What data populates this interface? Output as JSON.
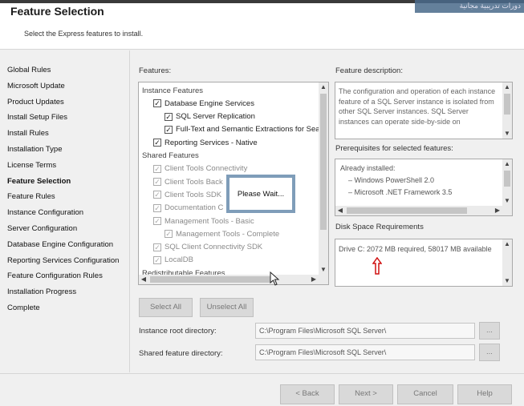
{
  "header": {
    "title": "Feature Selection",
    "subtitle": "Select the Express features to install.",
    "watermark": "دورات تدريبية مجانية"
  },
  "nav": {
    "items": [
      {
        "label": "Global Rules",
        "active": false
      },
      {
        "label": "Microsoft Update",
        "active": false
      },
      {
        "label": "Product Updates",
        "active": false
      },
      {
        "label": "Install Setup Files",
        "active": false
      },
      {
        "label": "Install Rules",
        "active": false
      },
      {
        "label": "Installation Type",
        "active": false
      },
      {
        "label": "License Terms",
        "active": false
      },
      {
        "label": "Feature Selection",
        "active": true
      },
      {
        "label": "Feature Rules",
        "active": false
      },
      {
        "label": "Instance Configuration",
        "active": false
      },
      {
        "label": "Server Configuration",
        "active": false
      },
      {
        "label": "Database Engine Configuration",
        "active": false
      },
      {
        "label": "Reporting Services Configuration",
        "active": false
      },
      {
        "label": "Feature Configuration Rules",
        "active": false
      },
      {
        "label": "Installation Progress",
        "active": false
      },
      {
        "label": "Complete",
        "active": false
      }
    ]
  },
  "features": {
    "label": "Features:",
    "rows": [
      {
        "label": "Instance Features",
        "type": "group"
      },
      {
        "label": "Database Engine Services",
        "type": "check",
        "checked": true,
        "indent": 1,
        "disabled": false
      },
      {
        "label": "SQL Server Replication",
        "type": "check",
        "checked": true,
        "indent": 2,
        "disabled": false
      },
      {
        "label": "Full-Text and Semantic Extractions for Sea",
        "type": "check",
        "checked": true,
        "indent": 2,
        "disabled": false
      },
      {
        "label": "Reporting Services - Native",
        "type": "check",
        "checked": true,
        "indent": 1,
        "disabled": false
      },
      {
        "label": "Shared Features",
        "type": "group"
      },
      {
        "label": "Client Tools Connectivity",
        "type": "check",
        "checked": true,
        "indent": 1,
        "disabled": true
      },
      {
        "label": "Client Tools Back",
        "type": "check",
        "checked": true,
        "indent": 1,
        "disabled": true
      },
      {
        "label": "Client Tools SDK",
        "type": "check",
        "checked": true,
        "indent": 1,
        "disabled": true
      },
      {
        "label": "Documentation C",
        "type": "check",
        "checked": true,
        "indent": 1,
        "disabled": true
      },
      {
        "label": "Management Tools - Basic",
        "type": "check",
        "checked": true,
        "indent": 1,
        "disabled": true
      },
      {
        "label": "Management Tools - Complete",
        "type": "check",
        "checked": true,
        "indent": 2,
        "disabled": true
      },
      {
        "label": "SQL Client Connectivity SDK",
        "type": "check",
        "checked": true,
        "indent": 1,
        "disabled": true
      },
      {
        "label": "LocalDB",
        "type": "check",
        "checked": true,
        "indent": 1,
        "disabled": true
      },
      {
        "label": "Redistributable Features",
        "type": "group"
      }
    ]
  },
  "wait_dialog": {
    "text": "Please Wait..."
  },
  "description": {
    "label": "Feature description:",
    "text": "The configuration and operation of each instance feature of a SQL Server instance is isolated from other SQL Server instances. SQL Server instances can operate side-by-side on"
  },
  "prerequisites": {
    "label": "Prerequisites for selected features:",
    "items": [
      {
        "label": "Already installed:",
        "indent": 0
      },
      {
        "label": "Windows PowerShell 2.0",
        "indent": 1
      },
      {
        "label": "Microsoft .NET Framework 3.5",
        "indent": 1
      }
    ]
  },
  "disk": {
    "label": "Disk Space Requirements",
    "text": "Drive C: 2072 MB required, 58017 MB available"
  },
  "buttons": {
    "select_all": "Select All",
    "unselect_all": "Unselect All",
    "browse": "...",
    "back": "< Back",
    "next": "Next >",
    "cancel": "Cancel",
    "help": "Help"
  },
  "paths": {
    "instance_root_label": "Instance root directory:",
    "instance_root_value": "C:\\Program Files\\Microsoft SQL Server\\",
    "shared_label": "Shared feature directory:",
    "shared_value": "C:\\Program Files\\Microsoft SQL Server\\"
  },
  "colors": {
    "annotation_arrow": "#d01010",
    "wait_border": "#7f9db9"
  }
}
